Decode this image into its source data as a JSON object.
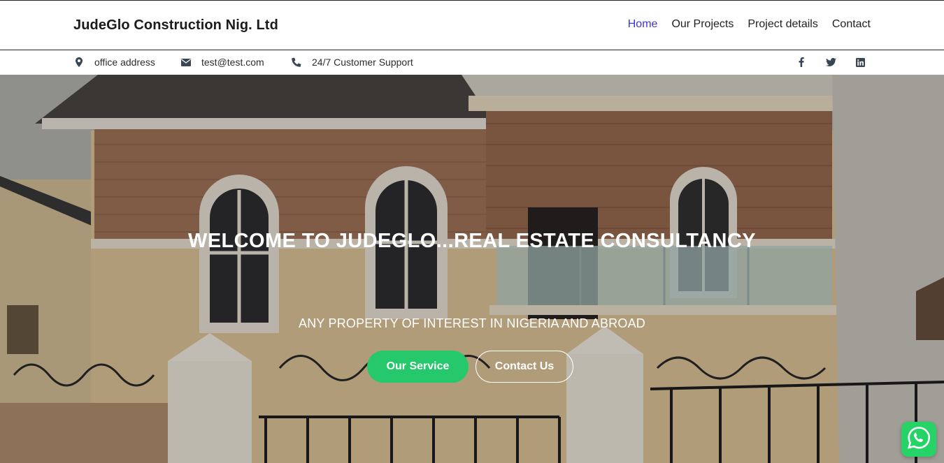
{
  "header": {
    "brand": "JudeGlo Construction Nig. Ltd",
    "nav": [
      {
        "label": "Home",
        "active": true
      },
      {
        "label": "Our Projects",
        "active": false
      },
      {
        "label": "Project details",
        "active": false
      },
      {
        "label": "Contact",
        "active": false
      }
    ]
  },
  "infobar": {
    "address": "office address",
    "email": "test@test.com",
    "support": "24/7 Customer Support",
    "icons": [
      "map-marker-icon",
      "envelope-icon",
      "phone-icon"
    ],
    "social": [
      "facebook-icon",
      "twitter-icon",
      "linkedin-icon"
    ]
  },
  "hero": {
    "title": "WELCOME TO JUDEGLO...REAL ESTATE CONSULTANCY",
    "subtitle": "ANY PROPERTY OF INTEREST IN NIGERIA AND ABROAD",
    "primary_button": "Our Service",
    "secondary_button": "Contact Us"
  },
  "colors": {
    "nav_active": "#3c36d4",
    "primary_button": "#25c86a",
    "whatsapp": "#25d366"
  },
  "floating": {
    "icon": "whatsapp-icon"
  }
}
